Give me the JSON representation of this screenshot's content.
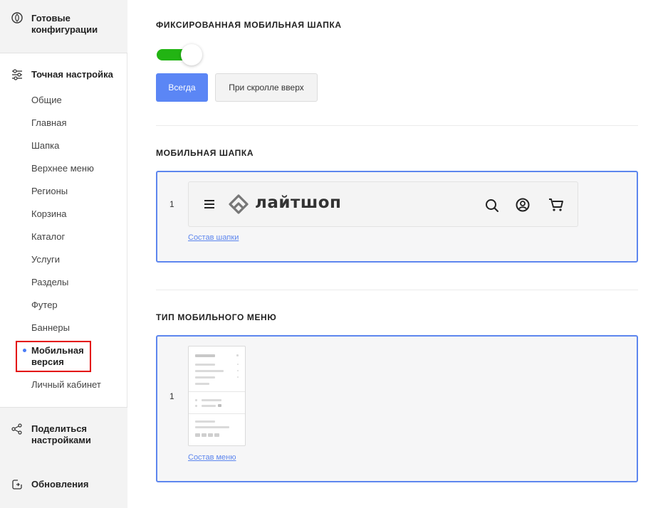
{
  "sidebar": {
    "top_section": {
      "label": "Готовые конфигурации",
      "icon": "compass-icon"
    },
    "fine_tune": {
      "label": "Точная настройка",
      "icon": "sliders-icon",
      "items": [
        {
          "label": "Общие"
        },
        {
          "label": "Главная"
        },
        {
          "label": "Шапка"
        },
        {
          "label": "Верхнее меню"
        },
        {
          "label": "Регионы"
        },
        {
          "label": "Корзина"
        },
        {
          "label": "Каталог"
        },
        {
          "label": "Услуги"
        },
        {
          "label": "Разделы"
        },
        {
          "label": "Футер"
        },
        {
          "label": "Баннеры"
        },
        {
          "label": "Мобильная версия",
          "active": true
        },
        {
          "label": "Личный кабинет"
        }
      ]
    },
    "share": {
      "label": "Поделиться настройками",
      "icon": "share-icon"
    },
    "updates": {
      "label": "Обновления",
      "icon": "update-icon"
    }
  },
  "fixed_header": {
    "title": "ФИКСИРОВАННАЯ МОБИЛЬНАЯ ШАПКА",
    "toggle_on": true,
    "options": [
      "Всегда",
      "При скролле вверх"
    ],
    "selected": "Всегда"
  },
  "mobile_header": {
    "title": "МОБИЛЬНАЯ ШАПКА",
    "number": "1",
    "logo_text": "лайтшоп",
    "link": "Состав шапки"
  },
  "mobile_menu": {
    "title": "ТИП МОБИЛЬНОГО МЕНЮ",
    "number": "1",
    "link": "Состав меню"
  },
  "colors": {
    "accent": "#5b86f5",
    "toggle": "#22b413",
    "highlight": "#e30000"
  }
}
